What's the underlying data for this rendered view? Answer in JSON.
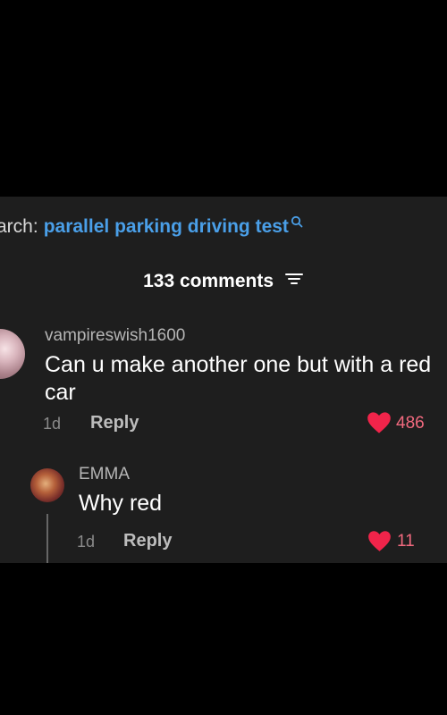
{
  "search": {
    "prefix": "arch:",
    "term": "parallel parking driving test"
  },
  "comments_header": {
    "label": "133 comments"
  },
  "comments": [
    {
      "username": "vampireswish1600",
      "text": "Can u make another one but with a red car",
      "time": "1d",
      "reply_label": "Reply",
      "likes": "486"
    },
    {
      "username": "EMMA",
      "text": "Why red",
      "time": "1d",
      "reply_label": "Reply",
      "likes": "11"
    }
  ],
  "colors": {
    "accent_blue": "#4a9fe8",
    "like_red": "#f0244a",
    "like_count": "#f26a7f",
    "panel_bg": "#1e1e1e"
  }
}
